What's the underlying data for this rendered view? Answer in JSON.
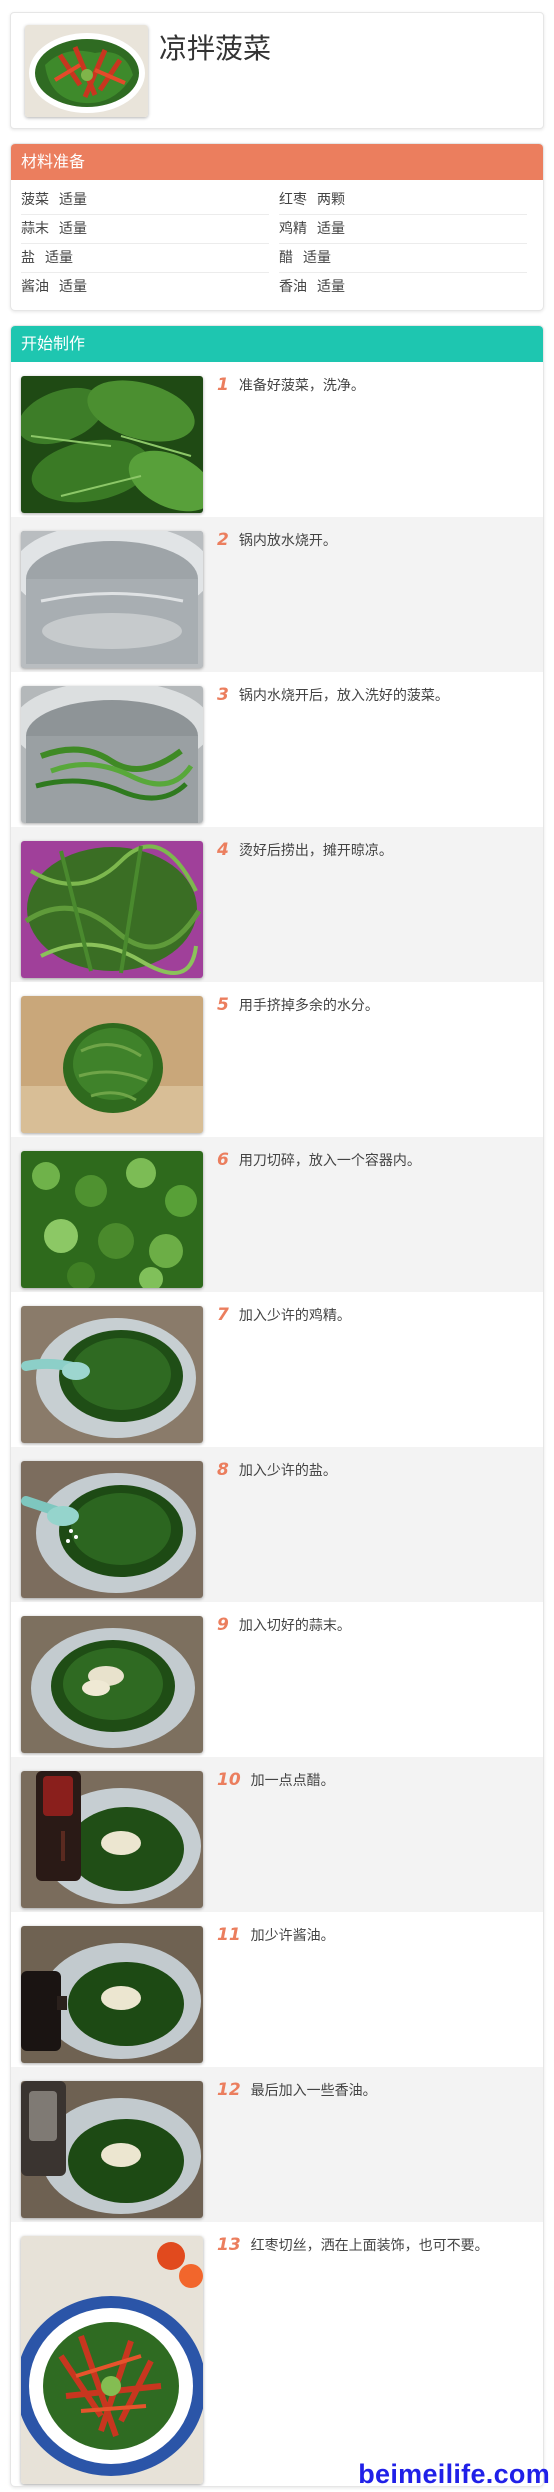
{
  "recipe": {
    "title": "凉拌菠菜"
  },
  "ingredients_section": {
    "heading": "材料准备",
    "rows": [
      [
        {
          "name": "菠菜",
          "amount": "适量"
        },
        {
          "name": "红枣",
          "amount": "两颗"
        }
      ],
      [
        {
          "name": "蒜末",
          "amount": "适量"
        },
        {
          "name": "鸡精",
          "amount": "适量"
        }
      ],
      [
        {
          "name": "盐",
          "amount": "适量"
        },
        {
          "name": "醋",
          "amount": "适量"
        }
      ],
      [
        {
          "name": "酱油",
          "amount": "适量"
        },
        {
          "name": "香油",
          "amount": "适量"
        }
      ]
    ]
  },
  "steps_section": {
    "heading": "开始制作",
    "steps": [
      {
        "num": "1",
        "text": "准备好菠菜，洗净。"
      },
      {
        "num": "2",
        "text": "锅内放水烧开。"
      },
      {
        "num": "3",
        "text": "锅内水烧开后，放入洗好的菠菜。"
      },
      {
        "num": "4",
        "text": "烫好后捞出，摊开晾凉。"
      },
      {
        "num": "5",
        "text": "用手挤掉多余的水分。"
      },
      {
        "num": "6",
        "text": "用刀切碎，放入一个容器内。"
      },
      {
        "num": "7",
        "text": "加入少许的鸡精。"
      },
      {
        "num": "8",
        "text": "加入少许的盐。"
      },
      {
        "num": "9",
        "text": "加入切好的蒜末。"
      },
      {
        "num": "10",
        "text": "加一点点醋。"
      },
      {
        "num": "11",
        "text": "加少许酱油。"
      },
      {
        "num": "12",
        "text": "最后加入一些香油。"
      },
      {
        "num": "13",
        "text": "红枣切丝，洒在上面装饰，也可不要。"
      }
    ]
  },
  "watermark": "beimeilife.com"
}
